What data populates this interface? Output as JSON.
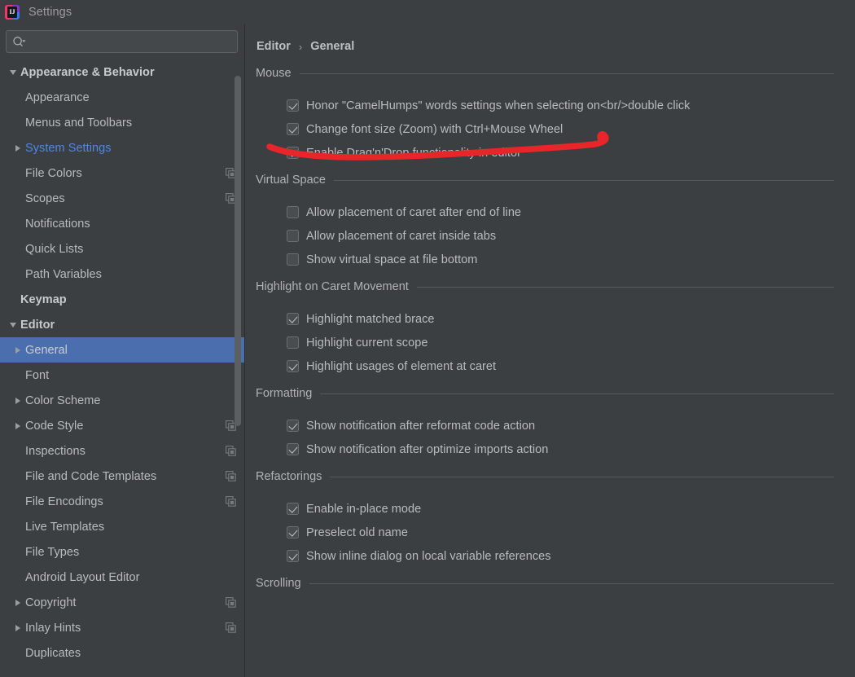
{
  "window": {
    "title": "Settings",
    "logo_icon": "intellij-idea-logo",
    "logo_letters": "IJ"
  },
  "sidebar": {
    "search": {
      "icon": "search-icon",
      "value": "",
      "placeholder": ""
    },
    "scrollbar": {
      "icon": "vertical-scrollbar"
    },
    "items": [
      {
        "label": "Appearance & Behavior",
        "depth": 0,
        "arrow": "down",
        "style": "top",
        "badge": ""
      },
      {
        "label": "Appearance",
        "depth": 1,
        "arrow": "none",
        "style": "normal",
        "badge": ""
      },
      {
        "label": "Menus and Toolbars",
        "depth": 1,
        "arrow": "none",
        "style": "normal",
        "badge": ""
      },
      {
        "label": "System Settings",
        "depth": 1,
        "arrow": "right",
        "style": "link",
        "badge": ""
      },
      {
        "label": "File Colors",
        "depth": 1,
        "arrow": "none",
        "style": "normal",
        "badge": "copy-icon"
      },
      {
        "label": "Scopes",
        "depth": 1,
        "arrow": "none",
        "style": "normal",
        "badge": "copy-icon"
      },
      {
        "label": "Notifications",
        "depth": 1,
        "arrow": "none",
        "style": "normal",
        "badge": ""
      },
      {
        "label": "Quick Lists",
        "depth": 1,
        "arrow": "none",
        "style": "normal",
        "badge": ""
      },
      {
        "label": "Path Variables",
        "depth": 1,
        "arrow": "none",
        "style": "normal",
        "badge": ""
      },
      {
        "label": "Keymap",
        "depth": 0,
        "arrow": "none",
        "style": "top",
        "badge": ""
      },
      {
        "label": "Editor",
        "depth": 0,
        "arrow": "down",
        "style": "top",
        "badge": ""
      },
      {
        "label": "General",
        "depth": 1,
        "arrow": "right",
        "style": "selected",
        "badge": ""
      },
      {
        "label": "Font",
        "depth": 1,
        "arrow": "none",
        "style": "normal",
        "badge": ""
      },
      {
        "label": "Color Scheme",
        "depth": 1,
        "arrow": "right",
        "style": "normal",
        "badge": ""
      },
      {
        "label": "Code Style",
        "depth": 1,
        "arrow": "right",
        "style": "normal",
        "badge": "copy-icon"
      },
      {
        "label": "Inspections",
        "depth": 1,
        "arrow": "none",
        "style": "normal",
        "badge": "copy-icon"
      },
      {
        "label": "File and Code Templates",
        "depth": 1,
        "arrow": "none",
        "style": "normal",
        "badge": "copy-icon"
      },
      {
        "label": "File Encodings",
        "depth": 1,
        "arrow": "none",
        "style": "normal",
        "badge": "copy-icon"
      },
      {
        "label": "Live Templates",
        "depth": 1,
        "arrow": "none",
        "style": "normal",
        "badge": ""
      },
      {
        "label": "File Types",
        "depth": 1,
        "arrow": "none",
        "style": "normal",
        "badge": ""
      },
      {
        "label": "Android Layout Editor",
        "depth": 1,
        "arrow": "none",
        "style": "normal",
        "badge": ""
      },
      {
        "label": "Copyright",
        "depth": 1,
        "arrow": "right",
        "style": "normal",
        "badge": "copy-icon"
      },
      {
        "label": "Inlay Hints",
        "depth": 1,
        "arrow": "right",
        "style": "normal",
        "badge": "copy-icon"
      },
      {
        "label": "Duplicates",
        "depth": 1,
        "arrow": "none",
        "style": "normal",
        "badge": ""
      }
    ]
  },
  "main": {
    "breadcrumb": {
      "parent": "Editor",
      "separator": "›",
      "current": "General"
    },
    "sections": [
      {
        "title": "Mouse",
        "options": [
          {
            "label": "Honor \"CamelHumps\" words settings when selecting on<br/>double click",
            "checked": true
          },
          {
            "label": "Change font size (Zoom) with Ctrl+Mouse Wheel",
            "checked": true
          },
          {
            "label": "Enable Drag'n'Drop functionality in editor",
            "checked": true
          }
        ]
      },
      {
        "title": "Virtual Space",
        "options": [
          {
            "label": "Allow placement of caret after end of line",
            "checked": false
          },
          {
            "label": "Allow placement of caret inside tabs",
            "checked": false
          },
          {
            "label": "Show virtual space at file bottom",
            "checked": false
          }
        ]
      },
      {
        "title": "Highlight on Caret Movement",
        "options": [
          {
            "label": "Highlight matched brace",
            "checked": true
          },
          {
            "label": "Highlight current scope",
            "checked": false
          },
          {
            "label": "Highlight usages of element at caret",
            "checked": true
          }
        ]
      },
      {
        "title": "Formatting",
        "options": [
          {
            "label": "Show notification after reformat code action",
            "checked": true
          },
          {
            "label": "Show notification after optimize imports action",
            "checked": true
          }
        ]
      },
      {
        "title": "Refactorings",
        "options": [
          {
            "label": "Enable in-place mode",
            "checked": true
          },
          {
            "label": "Preselect old name",
            "checked": true
          },
          {
            "label": "Show inline dialog on local variable references",
            "checked": true
          }
        ]
      },
      {
        "title": "Scrolling",
        "options": []
      }
    ]
  },
  "annotation": {
    "kind": "handdrawn-underline-swoosh",
    "color": "#e8262a",
    "targets_option": "Change font size (Zoom) with Ctrl+Mouse Wheel"
  },
  "colors": {
    "background": "#3c3f41",
    "selection": "#4b6eaf",
    "link_text": "#4d87e8",
    "text": "#b9bcbe",
    "separator": "#555a5c",
    "annotation_red": "#e8262a"
  }
}
